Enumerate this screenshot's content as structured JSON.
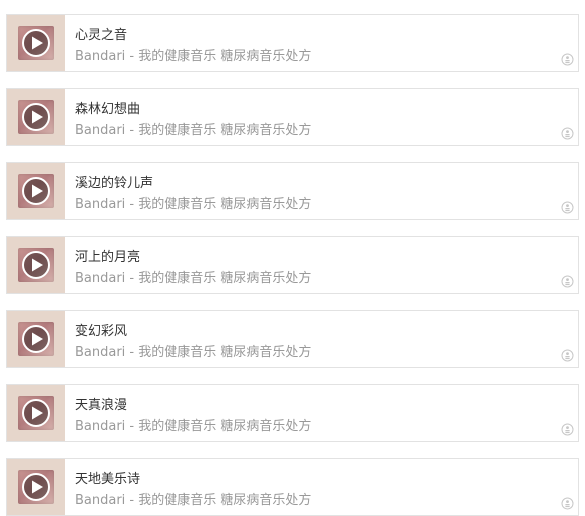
{
  "playlist": {
    "items": [
      {
        "title": "心灵之音",
        "subtitle": "Bandari - 我的健康音乐 糖尿病音乐处方"
      },
      {
        "title": "森林幻想曲",
        "subtitle": "Bandari - 我的健康音乐 糖尿病音乐处方"
      },
      {
        "title": "溪边的铃儿声",
        "subtitle": "Bandari - 我的健康音乐 糖尿病音乐处方"
      },
      {
        "title": "河上的月亮",
        "subtitle": "Bandari - 我的健康音乐 糖尿病音乐处方"
      },
      {
        "title": "变幻彩风",
        "subtitle": "Bandari - 我的健康音乐 糖尿病音乐处方"
      },
      {
        "title": "天真浪漫",
        "subtitle": "Bandari - 我的健康音乐 糖尿病音乐处方"
      },
      {
        "title": "天地美乐诗",
        "subtitle": "Bandari - 我的健康音乐 糖尿病音乐处方"
      }
    ],
    "icons": {
      "play": "play-icon",
      "badge": "music-source-icon"
    },
    "colors": {
      "thumb_background": "#e6d6cb",
      "card_border": "#e2e2e2",
      "title": "#333333",
      "subtitle": "#999999"
    }
  }
}
